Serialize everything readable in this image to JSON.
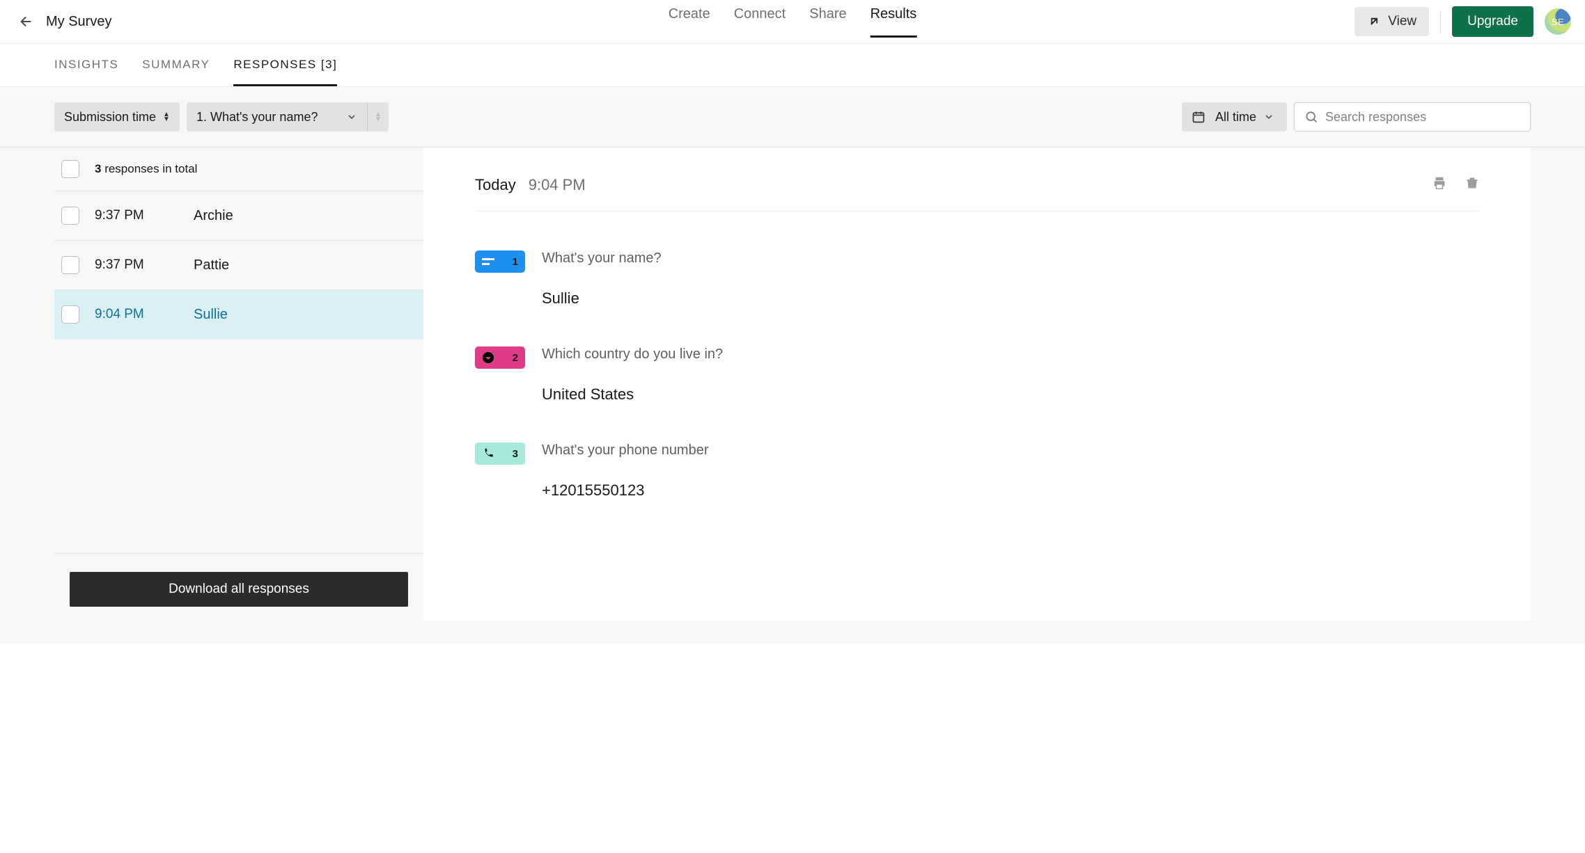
{
  "header": {
    "survey_title": "My Survey",
    "nav": [
      "Create",
      "Connect",
      "Share",
      "Results"
    ],
    "active_nav_index": 3,
    "view_label": "View",
    "upgrade_label": "Upgrade",
    "avatar_initials": "SE"
  },
  "subtabs": {
    "items": [
      "INSIGHTS",
      "SUMMARY",
      "RESPONSES [3]"
    ],
    "active_index": 2
  },
  "toolbar": {
    "sort_label": "Submission time",
    "question_selector": "1. What's your name?",
    "date_range": "All time",
    "search_placeholder": "Search responses"
  },
  "response_list": {
    "total_count": "3",
    "total_suffix": " responses in total",
    "rows": [
      {
        "time": "9:37 PM",
        "name": "Archie",
        "selected": false
      },
      {
        "time": "9:37 PM",
        "name": "Pattie",
        "selected": false
      },
      {
        "time": "9:04 PM",
        "name": "Sullie",
        "selected": true
      }
    ],
    "download_label": "Download all responses"
  },
  "detail": {
    "day_label": "Today",
    "time": "9:04 PM",
    "questions": [
      {
        "num": "1",
        "badge": "blue",
        "icon": "short-text",
        "q": "What's your name?",
        "a": "Sullie"
      },
      {
        "num": "2",
        "badge": "pink",
        "icon": "dropdown",
        "q": "Which country do you live in?",
        "a": "United States"
      },
      {
        "num": "3",
        "badge": "mint",
        "icon": "phone",
        "q": "What's your phone number",
        "a": "+12015550123"
      }
    ]
  }
}
